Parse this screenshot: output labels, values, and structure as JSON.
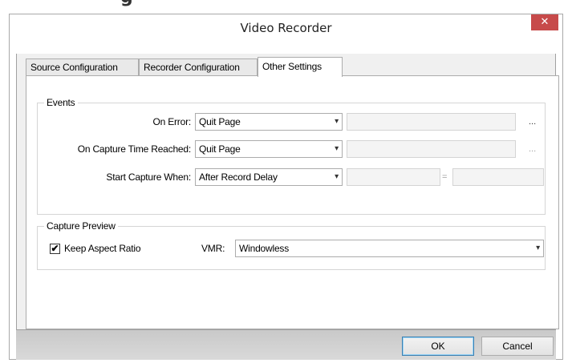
{
  "window": {
    "title": "Video Recorder",
    "close_glyph": "✕",
    "top_cut_text": "g"
  },
  "tabs": [
    {
      "label": "Source Configuration",
      "active": false
    },
    {
      "label": "Recorder Configuration",
      "active": false
    },
    {
      "label": "Other Settings",
      "active": true
    }
  ],
  "events": {
    "group_label": "Events",
    "on_error": {
      "label": "On Error:",
      "value": "Quit Page",
      "browse": "..."
    },
    "on_capture_time": {
      "label": "On Capture Time Reached:",
      "value": "Quit Page",
      "browse": "..."
    },
    "start_capture": {
      "label": "Start Capture When:",
      "value": "After Record Delay",
      "equals": "="
    }
  },
  "capture_preview": {
    "group_label": "Capture Preview",
    "keep_aspect_label": "Keep Aspect Ratio",
    "keep_aspect_checked": true,
    "vmr_label": "VMR:",
    "vmr_value": "Windowless"
  },
  "buttons": {
    "ok": "OK",
    "cancel": "Cancel"
  },
  "icons": {
    "dropdown": "chevron-down-icon",
    "check": "✔",
    "arrow_glyph": "▾"
  },
  "colors": {
    "close_button": "#c74a4a",
    "ok_border": "#3c7fb1"
  }
}
